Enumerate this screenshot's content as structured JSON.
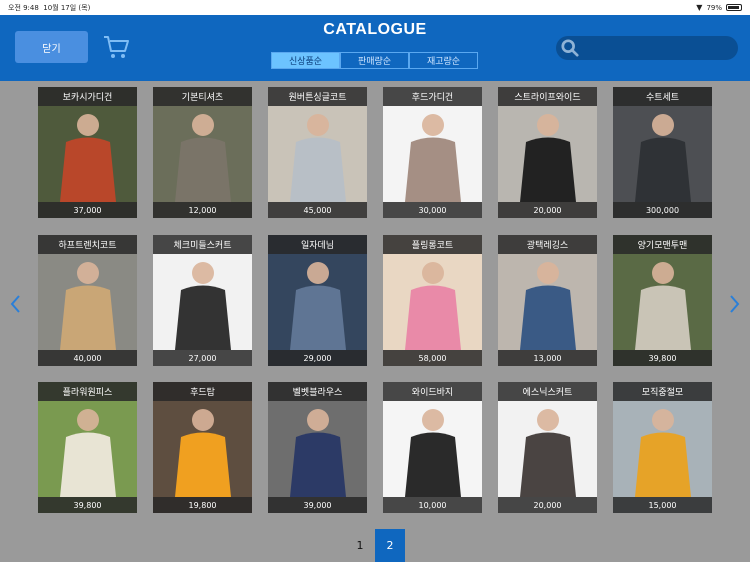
{
  "status": {
    "time": "오전 9:48",
    "date": "10월 17일 (목)",
    "battery": "79%",
    "battery_level": 0.79
  },
  "header": {
    "title": "CATALOGUE",
    "close_label": "닫기",
    "tabs": [
      {
        "label": "신상품순",
        "active": true
      },
      {
        "label": "판매량순",
        "active": false
      },
      {
        "label": "재고량순",
        "active": false
      }
    ],
    "search_placeholder": ""
  },
  "products": [
    {
      "name": "보카시가디건",
      "price": "37,000",
      "bg": "#4f5a3c",
      "fg": "#b9472a"
    },
    {
      "name": "기본티셔츠",
      "price": "12,000",
      "bg": "#6b6e5a",
      "fg": "#7a7468"
    },
    {
      "name": "원버튼싱글코트",
      "price": "45,000",
      "bg": "#c9c3b8",
      "fg": "#b8bfc6"
    },
    {
      "name": "후드가디건",
      "price": "30,000",
      "bg": "#f4f4f4",
      "fg": "#a58f84"
    },
    {
      "name": "스트라이프와이드",
      "price": "20,000",
      "bg": "#b9b6b0",
      "fg": "#222222"
    },
    {
      "name": "수트세트",
      "price": "300,000",
      "bg": "#4d4f53",
      "fg": "#2f3236"
    },
    {
      "name": "하프트렌치코트",
      "price": "40,000",
      "bg": "#8a8a84",
      "fg": "#c9a676"
    },
    {
      "name": "체크미들스커트",
      "price": "27,000",
      "bg": "#f2f2f2",
      "fg": "#333333"
    },
    {
      "name": "일자데님",
      "price": "29,000",
      "bg": "#34465e",
      "fg": "#5f7594"
    },
    {
      "name": "플링롱코트",
      "price": "58,000",
      "bg": "#e9d7c3",
      "fg": "#e98aa8"
    },
    {
      "name": "광택레깅스",
      "price": "13,000",
      "bg": "#bdb6ae",
      "fg": "#3a5a85"
    },
    {
      "name": "양기모맨투맨",
      "price": "39,800",
      "bg": "#5a6a45",
      "fg": "#c9c4b6"
    },
    {
      "name": "플라워원피스",
      "price": "39,800",
      "bg": "#7a9a50",
      "fg": "#e8e4d4"
    },
    {
      "name": "후드탑",
      "price": "19,800",
      "bg": "#5e4e40",
      "fg": "#f0a020"
    },
    {
      "name": "벨벳블라우스",
      "price": "39,000",
      "bg": "#6e6e6e",
      "fg": "#2c3a66"
    },
    {
      "name": "와이드바지",
      "price": "10,000",
      "bg": "#f5f5f5",
      "fg": "#2a2a2a"
    },
    {
      "name": "에스닉스커트",
      "price": "20,000",
      "bg": "#f2f2f2",
      "fg": "#4a4442"
    },
    {
      "name": "모직중절모",
      "price": "15,000",
      "bg": "#a8b2b8",
      "fg": "#e6a328"
    }
  ],
  "pagination": {
    "pages": [
      "1",
      "2"
    ],
    "current": "2"
  },
  "colors": {
    "header": "#0f67bf",
    "accent": "#6cc3ff",
    "background": "#9a9a9a"
  }
}
